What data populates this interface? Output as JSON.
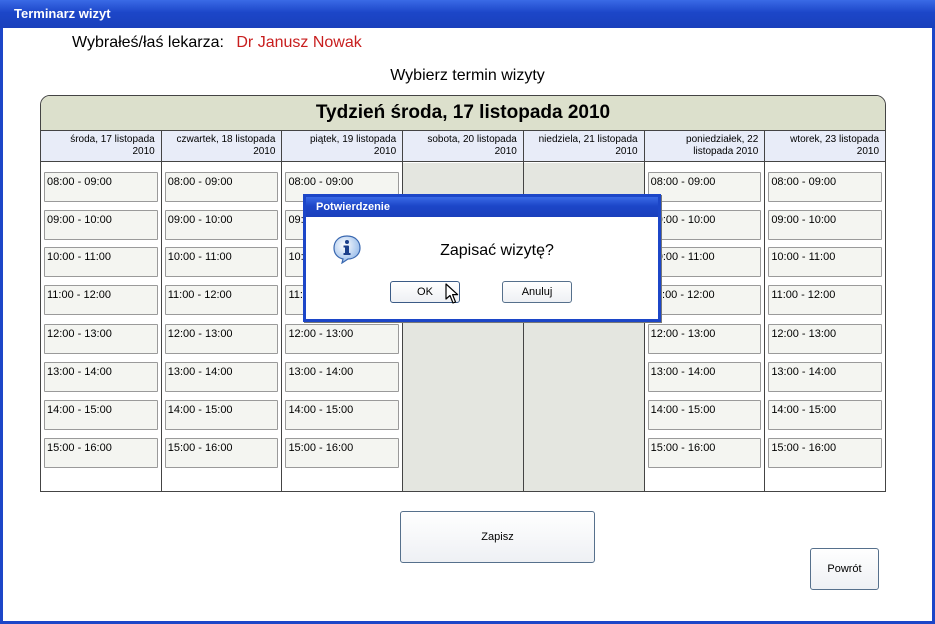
{
  "window": {
    "title": "Terminarz wizyt"
  },
  "doctor": {
    "label": "Wybrałeś/łaś lekarza:",
    "name": "Dr Janusz Nowak"
  },
  "subtitle": "Wybierz termin wizyty",
  "calendar": {
    "week_title": "Tydzień środa, 17 listopada 2010",
    "days": [
      {
        "label": "środa, 17 listopada 2010",
        "weekend": false
      },
      {
        "label": "czwartek, 18 listopada 2010",
        "weekend": false
      },
      {
        "label": "piątek, 19 listopada 2010",
        "weekend": false
      },
      {
        "label": "sobota, 20 listopada 2010",
        "weekend": true
      },
      {
        "label": "niedziela, 21 listopada 2010",
        "weekend": true
      },
      {
        "label": "poniedziałek, 22 listopada 2010",
        "weekend": false
      },
      {
        "label": "wtorek, 23 listopada 2010",
        "weekend": false
      }
    ],
    "slots": [
      "08:00 - 09:00",
      "09:00 - 10:00",
      "10:00 - 11:00",
      "11:00 - 12:00",
      "12:00 - 13:00",
      "13:00 - 14:00",
      "14:00 - 15:00",
      "15:00 - 16:00"
    ]
  },
  "buttons": {
    "save": "Zapisz",
    "back": "Powrót"
  },
  "dialog": {
    "title": "Potwierdzenie",
    "message": "Zapisać wizytę?",
    "ok": "OK",
    "cancel": "Anuluj",
    "icon": "info-icon"
  },
  "colors": {
    "titlebar": "#1c46c8",
    "doctor_name": "#c81e1e",
    "weekend": "#e4e6e0"
  }
}
